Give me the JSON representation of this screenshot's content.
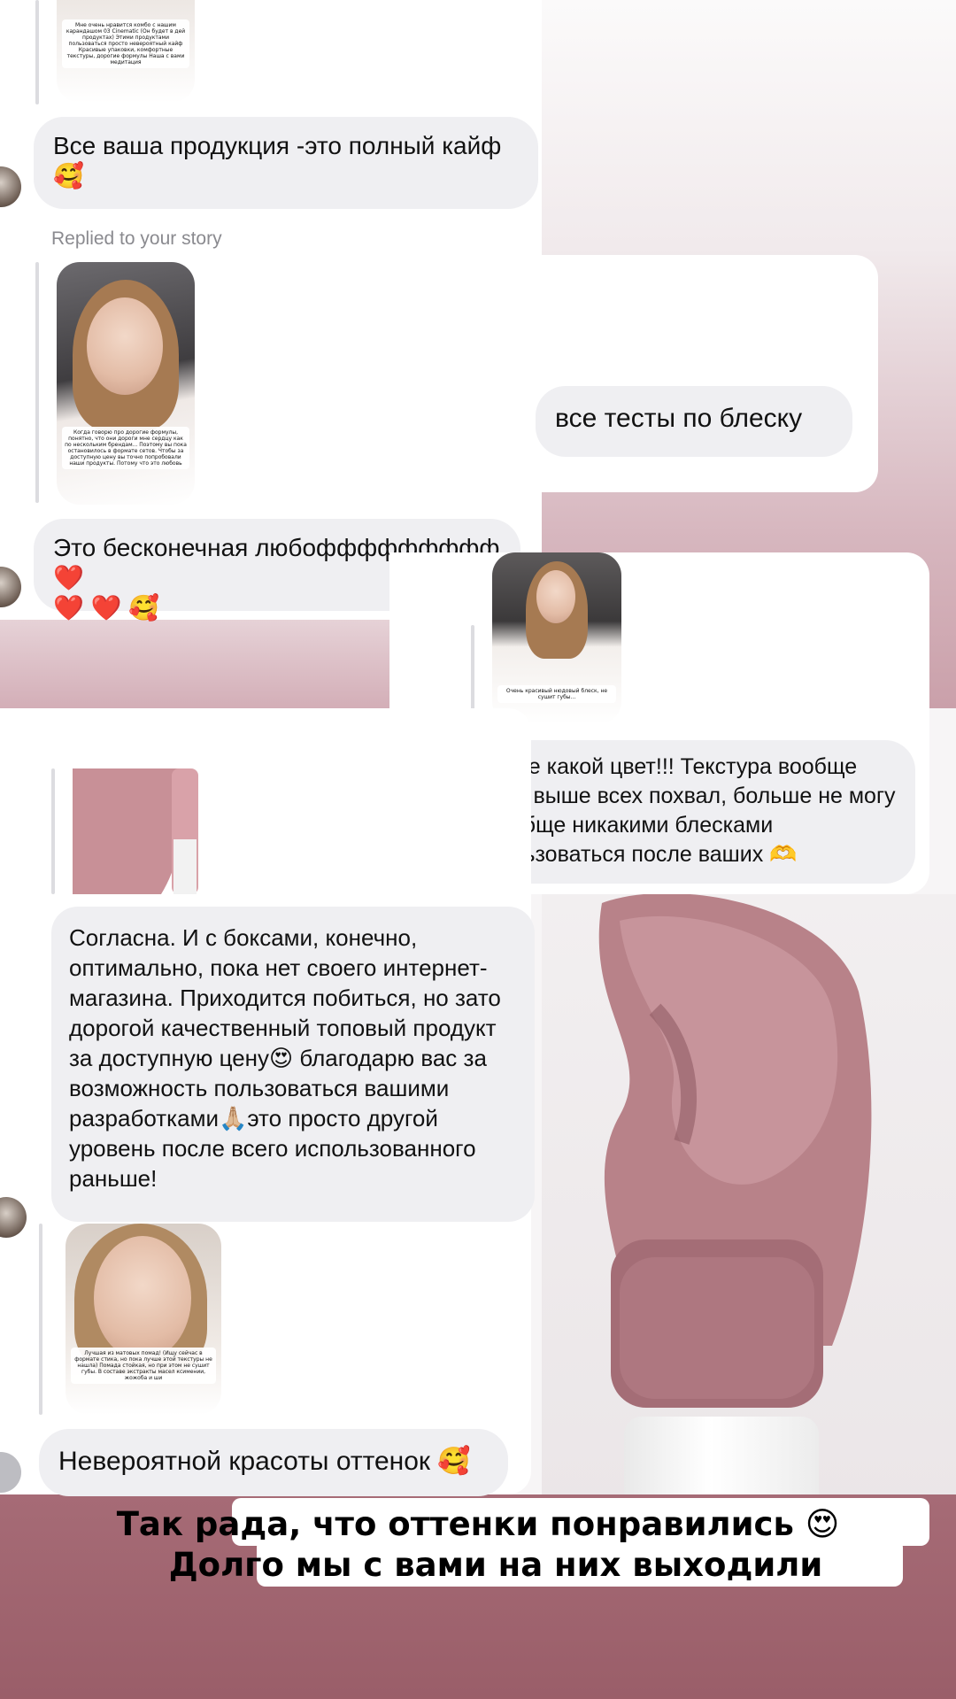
{
  "chat": {
    "replied_label": "Replied to your story",
    "messages": [
      {
        "text_line1": "Все ваша продукция -это полный кайф",
        "text_line2": "🥰"
      },
      {
        "text": "все тесты по блеску"
      },
      {
        "text_line1": "Это бесконечная любоффффффффф❤️",
        "text_line2": "❤️ ❤️ 🥰"
      },
      {
        "text": "Боже какой цвет!!! Текстура вообще топ, выше всех похвал, больше не могу вообще никакими блесками пользоваться после ваших 🫶"
      },
      {
        "text": "Согласна. И с боксами, конечно, оптимально, пока нет своего интернет-магазина. Приходится побиться, но зато дорогой качественный топовый продукт за доступную цену😍 благодарю вас за возможность пользоваться вашими разработками🙏🏼это просто другой уровень после всего использованного раньше!"
      },
      {
        "text": "Невероятной красоты оттенок 🥰"
      }
    ],
    "story_captions": [
      "Мне очень нравится комбо с нашим карандашом 03 Cinematic (Он будет в дей продуктах) Этими продуктами пользоваться просто невероятный кайф Красивые упаковки, комфортные текстуры, дорогие формулы Наша с вами медитация",
      "Когда говорю про дорогие формулы, понятно, что они дороги мне сердцу как по нескольким брендам... Поэтому вы пока остановилось в формате сетов. Чтобы за доступную цену вы точно попробовали наши продукты. Потому что это любовь",
      "Очень красивый нюдовый блеск, не сушит губы...",
      "Лучшая из матовых помад! (Ищу сейчас в формате стика, но пока лучше этой текстуры не нашла) Помада стойкая, но при этом не сушит губы. В составе экстракты масел ксимении, жожоба и ши"
    ]
  },
  "overlay_caption": {
    "line1": "Так рада, что оттенки понравились 😍",
    "line2": "Долго мы с вами на них выходили"
  },
  "colors": {
    "bubble_bg": "#efeff2",
    "accent_pink": "#b07a84",
    "bottom_band": "#a66b76"
  }
}
